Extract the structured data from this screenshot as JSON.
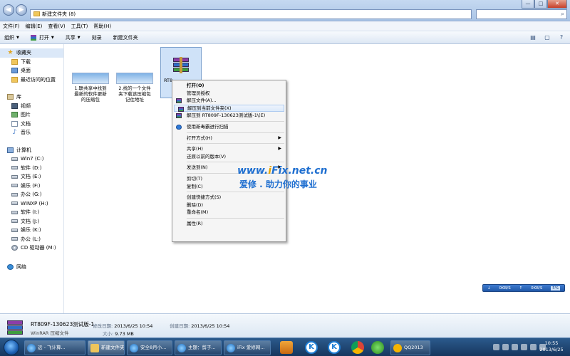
{
  "window": {
    "address": "新建文件夹 (8)",
    "nav_back": "◀",
    "nav_forward": "▶",
    "btn_min": "—",
    "btn_max": "□",
    "btn_close": "✕"
  },
  "menubar": [
    "文件(F)",
    "编辑(E)",
    "查看(V)",
    "工具(T)",
    "帮助(H)"
  ],
  "toolbar": {
    "organize": "组织",
    "open": "打开",
    "share": "共享",
    "burn": "刻录",
    "new_folder": "新建文件夹",
    "caret": "▼"
  },
  "sidebar": {
    "favorites": {
      "label": "收藏夹",
      "items": [
        "下载",
        "桌面",
        "最近访问的位置"
      ]
    },
    "libraries": {
      "label": "库",
      "items": [
        "视频",
        "图片",
        "文档",
        "音乐"
      ]
    },
    "computer": {
      "label": "计算机",
      "items": [
        "Win7 (C:)",
        "软件 (D:)",
        "文档 (E:)",
        "娱乐 (F:)",
        "办公 (G:)",
        "WINXP (H:)",
        "软件 (I:)",
        "文档 (J:)",
        "娱乐 (K:)",
        "办公 (L:)",
        "CD 驱动器 (M:)"
      ]
    },
    "network": {
      "label": "网络"
    }
  },
  "files": [
    {
      "name_line1": "1.联共享中找到",
      "name_line2": "最新的软件更新",
      "name_line3": "的压缩包"
    },
    {
      "name_line1": "2.找的一个文件",
      "name_line2": "夹下载该压缩包",
      "name_line3": "记住地址"
    },
    {
      "name": "RT8"
    }
  ],
  "context_menu": [
    {
      "label": "打开(O)",
      "bold": true
    },
    {
      "label": "管理员授权"
    },
    {
      "label": "解压文件(A)...",
      "icon": "rar"
    },
    {
      "label": "解压到当前文件夹(X)",
      "icon": "rar",
      "highlight": true
    },
    {
      "label": "解压到 RT809F-130623测试版-1\\(E)",
      "icon": "rar"
    },
    {
      "sep": true
    },
    {
      "label": "使用新毒霸进行扫描",
      "icon": "shield"
    },
    {
      "sep": true
    },
    {
      "label": "打开方式(H)",
      "submenu": true
    },
    {
      "sep": true
    },
    {
      "label": "共享(H)",
      "submenu": true
    },
    {
      "label": "还原以前的版本(V)"
    },
    {
      "sep": true
    },
    {
      "label": "发送到(N)",
      "submenu": true
    },
    {
      "sep": true
    },
    {
      "label": "剪切(T)"
    },
    {
      "label": "复制(C)"
    },
    {
      "sep": true
    },
    {
      "label": "创建快捷方式(S)"
    },
    {
      "label": "删除(D)"
    },
    {
      "label": "重命名(M)"
    },
    {
      "sep": true
    },
    {
      "label": "属性(R)"
    }
  ],
  "watermark": {
    "line1_pre": "www.",
    "line1_i": "i",
    "line1_post": "Fix.net.cn",
    "line2": "爱修 . 助力你的事业"
  },
  "speed": {
    "down": "0KB/S",
    "up": "0KB/S",
    "percent": "5%",
    "down_arrow": "↓",
    "up_arrow": "↑"
  },
  "details": {
    "filename": "RT809F-130623测试版-1",
    "filetype": "WinRAR 压缩文件",
    "modified_label": "修改日期:",
    "modified_value": "2013/6/25 10:54",
    "created_label": "创建日期:",
    "created_value": "2013/6/25 10:54",
    "size_label": "大小:",
    "size_value": "9.73 MB"
  },
  "taskbar": {
    "tasks": [
      {
        "label": "远 - 飞计算...",
        "icon": "ie"
      },
      {
        "label": "新建文件夹 ...",
        "icon": "fold",
        "active": true
      },
      {
        "label": "安全8月小...",
        "icon": "ie"
      },
      {
        "label": "主题：剪子...",
        "icon": "ie"
      },
      {
        "label": "iFix 爱修网...",
        "icon": "ie"
      },
      {
        "label": "QQ2013",
        "icon": "qq"
      }
    ],
    "pin_k": "K",
    "clock_time": "10:55",
    "clock_date": "2013/6/25"
  },
  "colors": {
    "accent": "#1f6fd0",
    "selection": "#cfe2f8",
    "taskbar": "#16365e"
  }
}
